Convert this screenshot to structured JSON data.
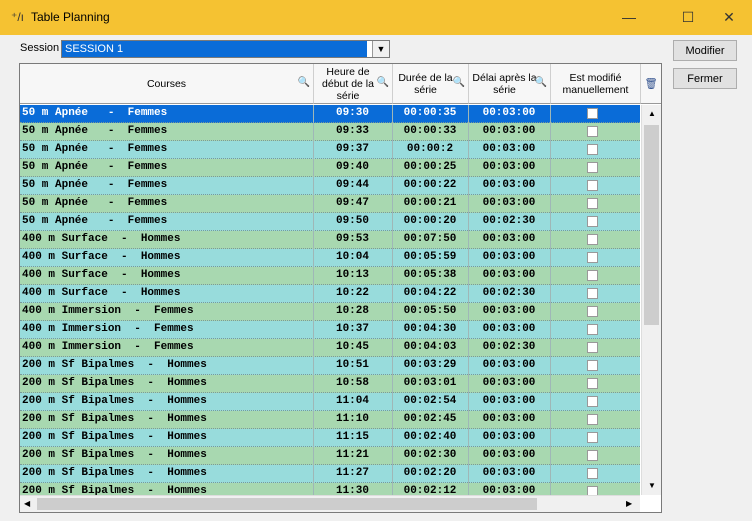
{
  "window": {
    "title": "Table Planning",
    "icon": "app-icon",
    "minimize": "—",
    "maximize": "☐",
    "close": "✕"
  },
  "session": {
    "label": "Session",
    "value": "SESSION 1"
  },
  "buttons": {
    "modifier": "Modifier",
    "fermer": "Fermer"
  },
  "columns": {
    "courses": "Courses",
    "heure": "Heure de début de la série",
    "duree": "Durée de la série",
    "delai": "Délai après la série",
    "modifie": "Est modifié manuellement"
  },
  "colors": {
    "selected": "#0a6cd8",
    "green": "#a8d8b0",
    "cyan": "#98dcdc",
    "title": "#f5c232"
  },
  "rows": [
    {
      "course": "50 m Apnée   -  Femmes",
      "time": "09:30",
      "dur": "00:00:35",
      "delay": "00:03:00",
      "selected": true
    },
    {
      "course": "50 m Apnée   -  Femmes",
      "time": "09:33",
      "dur": "00:00:33",
      "delay": "00:03:00",
      "color": "green"
    },
    {
      "course": "50 m Apnée   -  Femmes",
      "time": "09:37",
      "dur": "00:00:2",
      "delay": "00:03:00",
      "color": "cyan"
    },
    {
      "course": "50 m Apnée   -  Femmes",
      "time": "09:40",
      "dur": "00:00:25",
      "delay": "00:03:00",
      "color": "green"
    },
    {
      "course": "50 m Apnée   -  Femmes",
      "time": "09:44",
      "dur": "00:00:22",
      "delay": "00:03:00",
      "color": "cyan"
    },
    {
      "course": "50 m Apnée   -  Femmes",
      "time": "09:47",
      "dur": "00:00:21",
      "delay": "00:03:00",
      "color": "green"
    },
    {
      "course": "50 m Apnée   -  Femmes",
      "time": "09:50",
      "dur": "00:00:20",
      "delay": "00:02:30",
      "color": "cyan"
    },
    {
      "course": "400 m Surface  -  Hommes",
      "time": "09:53",
      "dur": "00:07:50",
      "delay": "00:03:00",
      "color": "green"
    },
    {
      "course": "400 m Surface  -  Hommes",
      "time": "10:04",
      "dur": "00:05:59",
      "delay": "00:03:00",
      "color": "cyan"
    },
    {
      "course": "400 m Surface  -  Hommes",
      "time": "10:13",
      "dur": "00:05:38",
      "delay": "00:03:00",
      "color": "green"
    },
    {
      "course": "400 m Surface  -  Hommes",
      "time": "10:22",
      "dur": "00:04:22",
      "delay": "00:02:30",
      "color": "cyan"
    },
    {
      "course": "400 m Immersion  -  Femmes",
      "time": "10:28",
      "dur": "00:05:50",
      "delay": "00:03:00",
      "color": "green"
    },
    {
      "course": "400 m Immersion  -  Femmes",
      "time": "10:37",
      "dur": "00:04:30",
      "delay": "00:03:00",
      "color": "cyan"
    },
    {
      "course": "400 m Immersion  -  Femmes",
      "time": "10:45",
      "dur": "00:04:03",
      "delay": "00:02:30",
      "color": "green"
    },
    {
      "course": "200 m Sf Bipalmes  -  Hommes",
      "time": "10:51",
      "dur": "00:03:29",
      "delay": "00:03:00",
      "color": "cyan"
    },
    {
      "course": "200 m Sf Bipalmes  -  Hommes",
      "time": "10:58",
      "dur": "00:03:01",
      "delay": "00:03:00",
      "color": "green"
    },
    {
      "course": "200 m Sf Bipalmes  -  Hommes",
      "time": "11:04",
      "dur": "00:02:54",
      "delay": "00:03:00",
      "color": "cyan"
    },
    {
      "course": "200 m Sf Bipalmes  -  Hommes",
      "time": "11:10",
      "dur": "00:02:45",
      "delay": "00:03:00",
      "color": "green"
    },
    {
      "course": "200 m Sf Bipalmes  -  Hommes",
      "time": "11:15",
      "dur": "00:02:40",
      "delay": "00:03:00",
      "color": "cyan"
    },
    {
      "course": "200 m Sf Bipalmes  -  Hommes",
      "time": "11:21",
      "dur": "00:02:30",
      "delay": "00:03:00",
      "color": "green"
    },
    {
      "course": "200 m Sf Bipalmes  -  Hommes",
      "time": "11:27",
      "dur": "00:02:20",
      "delay": "00:03:00",
      "color": "cyan"
    },
    {
      "course": "200 m Sf Bipalmes  -  Hommes",
      "time": "11:30",
      "dur": "00:02:12",
      "delay": "00:03:00",
      "color": "green"
    }
  ]
}
